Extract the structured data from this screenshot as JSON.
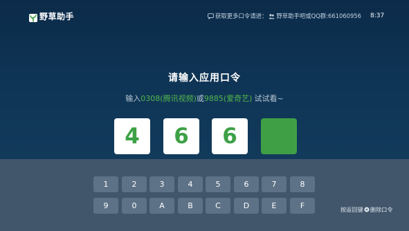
{
  "header": {
    "brand_name": "野草助手",
    "notice_text": "获取更多口令请进：",
    "notice_group": "野草助手吧或QQ群:661060956",
    "time": "8:37"
  },
  "main": {
    "title": "请输入应用口令",
    "hint": {
      "prefix": "输入",
      "code1": "0308",
      "app1": "(腾讯视频)",
      "or": "或",
      "code2": "9885",
      "app2": "(爱奇艺)",
      "suffix": "试试看~"
    },
    "code_digits": [
      "4",
      "6",
      "6",
      ""
    ]
  },
  "keypad": {
    "keys": [
      "1",
      "2",
      "3",
      "4",
      "5",
      "6",
      "7",
      "8",
      "9",
      "0",
      "A",
      "B",
      "C",
      "D",
      "E",
      "F"
    ]
  },
  "footer": {
    "back_prefix": "按返回键",
    "back_suffix": "删除口令"
  },
  "colors": {
    "accent_green": "#3f9f45",
    "background_dark": "#0d2f4e",
    "keypad_bg": "#41566b",
    "key_bg": "#5d7286"
  },
  "icons": {
    "brand": "wild-grass-logo-icon",
    "notice": "message-icon",
    "group": "group-chat-icon",
    "back": "circle-back-icon"
  }
}
